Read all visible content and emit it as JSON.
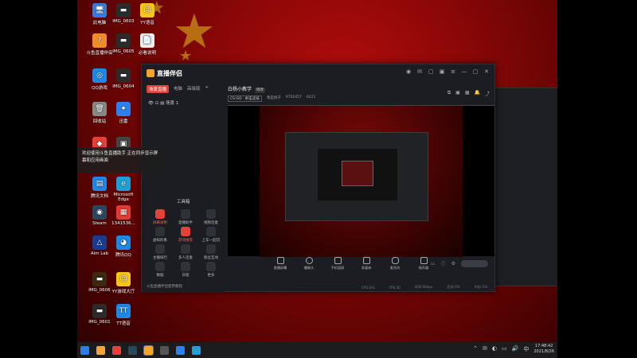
{
  "desktop_icons": [
    {
      "label": "此电脑",
      "color": "#3a7bd5",
      "glyph": "🖥"
    },
    {
      "label": "IMG_0603",
      "color": "#2b2b2b",
      "glyph": "▬"
    },
    {
      "label": "YY语音",
      "color": "#f5c518",
      "glyph": "☺"
    },
    {
      "label": "斗鱼直播伴侣",
      "color": "#f28c28",
      "glyph": "?"
    },
    {
      "label": "IMG_0605",
      "color": "#2b2b2b",
      "glyph": "▬"
    },
    {
      "label": "必看说明",
      "color": "#eeeeee",
      "glyph": "📄"
    },
    {
      "label": "QQ游戏",
      "color": "#1e88e5",
      "glyph": "◎"
    },
    {
      "label": "IMG_0604",
      "color": "#2b2b2b",
      "glyph": "▬"
    },
    {
      "label": "回收站",
      "color": "#888888",
      "glyph": "🗑"
    },
    {
      "label": "迅雷",
      "color": "#2f80ed",
      "glyph": "✦"
    },
    {
      "label": "斗鱼鼠标中心",
      "color": "#e5403a",
      "glyph": "◆"
    },
    {
      "label": "Global Off...",
      "color": "#444444",
      "glyph": "▣"
    },
    {
      "label": "腾讯文档",
      "color": "#1e88e5",
      "glyph": "▤"
    },
    {
      "label": "Microsoft Edge",
      "color": "#1f9fd6",
      "glyph": "e"
    },
    {
      "label": "Steam",
      "color": "#2a475e",
      "glyph": "◉"
    },
    {
      "label": "1341536...",
      "color": "#e53935",
      "glyph": "▦"
    },
    {
      "label": "Aim Lab",
      "color": "#1a3c8f",
      "glyph": "△"
    },
    {
      "label": "腾讯QQ",
      "color": "#1e88e5",
      "glyph": "◕"
    },
    {
      "label": "IMG_0606",
      "color": "#3a2a10",
      "glyph": "▬"
    },
    {
      "label": "YY游戏大厅",
      "color": "#f5c518",
      "glyph": "☺"
    },
    {
      "label": "IMG_0601",
      "color": "#2b2b2b",
      "glyph": "▬"
    },
    {
      "label": "TT语音",
      "color": "#1e88e5",
      "glyph": "TT"
    }
  ],
  "app": {
    "title": "直播伴侣",
    "tabs": [
      "场景直播",
      "电脑",
      "高级版"
    ],
    "scene": "场景 1",
    "toast": "欢迎使用斗鱼直播助手 正在同步显示屏幕和应用画面",
    "tools_title": "工具箱",
    "tools": [
      {
        "label": "屏幕录制",
        "hot": true
      },
      {
        "label": "直播助手",
        "hot": false
      },
      {
        "label": "视频连麦",
        "hot": false
      },
      {
        "label": "虚拟形象",
        "hot": false
      },
      {
        "label": "游戏推荐",
        "hot": true
      },
      {
        "label": "上车一起玩",
        "hot": false
      },
      {
        "label": "主播排行",
        "hot": false
      },
      {
        "label": "多人连麦",
        "hot": false
      },
      {
        "label": "粉丝互动",
        "hot": false
      },
      {
        "label": "数据",
        "hot": false
      },
      {
        "label": "日程",
        "hot": false
      },
      {
        "label": "更多",
        "hot": false
      }
    ],
    "bottom_hint": "斗鱼直播伴侣使用教程",
    "room": {
      "title": "白杨小教学",
      "tag": "修改",
      "category": "CS:GO · 射击竞技",
      "owner": "我是杨子",
      "room_id": "9702457",
      "followers": "6221"
    },
    "controls": [
      "直播屏幕",
      "摄像头",
      "手机投屏",
      "多媒体",
      "麦克风",
      "扬声器"
    ],
    "start_button_label": "",
    "status": [
      "CPU:3%",
      "FPS:30",
      "码率:0kbps",
      "丢帧:0%",
      "内存:1%"
    ]
  },
  "taskbar": {
    "time": "17:48:42",
    "date": "2021/8/26",
    "apps": [
      {
        "name": "start",
        "color": "#2b7de9"
      },
      {
        "name": "chrome",
        "color": "#f2a33a"
      },
      {
        "name": "douyu",
        "color": "#e5403a"
      },
      {
        "name": "steam",
        "color": "#2a475e"
      },
      {
        "name": "live-companion",
        "color": "#f5a623",
        "active": true
      },
      {
        "name": "obs",
        "color": "#555555"
      },
      {
        "name": "xunlei",
        "color": "#2f80ed"
      },
      {
        "name": "edge",
        "color": "#1f9fd6"
      }
    ],
    "tray_glyphs": [
      "⌃",
      "✉",
      "◐",
      "▭",
      "🔊",
      "中"
    ]
  }
}
